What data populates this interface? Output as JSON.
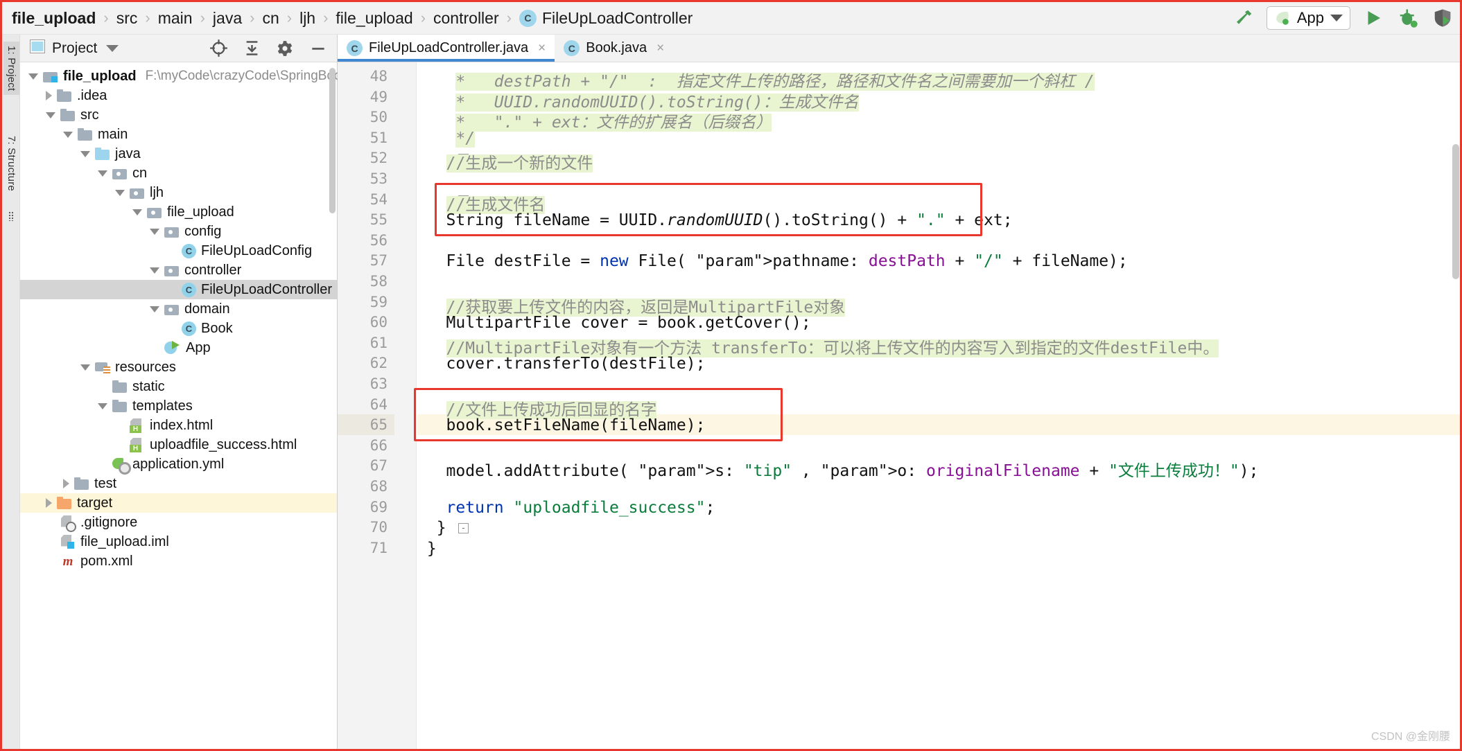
{
  "breadcrumb": {
    "items": [
      {
        "label": "file_upload",
        "bold": true
      },
      {
        "label": "src",
        "bold": false
      },
      {
        "label": "main",
        "bold": false
      },
      {
        "label": "java",
        "bold": false
      },
      {
        "label": "cn",
        "bold": false
      },
      {
        "label": "ljh",
        "bold": false
      },
      {
        "label": "file_upload",
        "bold": false
      },
      {
        "label": "controller",
        "bold": false
      }
    ],
    "current_class": "FileUpLoadController",
    "class_badge": "C",
    "separator": "›"
  },
  "toolbar": {
    "build_icon": "hammer-icon",
    "run_config": "App",
    "run_icon": "run-icon",
    "debug_icon": "debug-icon",
    "coverage_icon": "run-with-coverage-icon"
  },
  "left_strip": {
    "project_tab": "1: Project",
    "structure_tab": "7: Structure"
  },
  "project_panel": {
    "title": "Project",
    "icons": [
      "locate-icon",
      "collapse-all-icon",
      "settings-icon",
      "hide-icon"
    ],
    "tree": [
      {
        "depth": 0,
        "arrow": "down",
        "icon": "module",
        "label": "file_upload",
        "bold": true,
        "path": "F:\\myCode\\crazyCode\\SpringBoot\\sprin",
        "state": "normal"
      },
      {
        "depth": 1,
        "arrow": "right",
        "icon": "folder",
        "label": ".idea",
        "bold": false,
        "path": "",
        "state": "normal"
      },
      {
        "depth": 1,
        "arrow": "down",
        "icon": "folder",
        "label": "src",
        "bold": false,
        "path": "",
        "state": "normal"
      },
      {
        "depth": 2,
        "arrow": "down",
        "icon": "folder",
        "label": "main",
        "bold": false,
        "path": "",
        "state": "normal"
      },
      {
        "depth": 3,
        "arrow": "down",
        "icon": "folder blue",
        "label": "java",
        "bold": false,
        "path": "",
        "state": "normal"
      },
      {
        "depth": 4,
        "arrow": "down",
        "icon": "pkg",
        "label": "cn",
        "bold": false,
        "path": "",
        "state": "normal"
      },
      {
        "depth": 5,
        "arrow": "down",
        "icon": "pkg",
        "label": "ljh",
        "bold": false,
        "path": "",
        "state": "normal"
      },
      {
        "depth": 6,
        "arrow": "down",
        "icon": "pkg",
        "label": "file_upload",
        "bold": false,
        "path": "",
        "state": "normal"
      },
      {
        "depth": 7,
        "arrow": "down",
        "icon": "pkg",
        "label": "config",
        "bold": false,
        "path": "",
        "state": "normal"
      },
      {
        "depth": 8,
        "arrow": "none",
        "icon": "cls",
        "label": "FileUpLoadConfig",
        "bold": false,
        "path": "",
        "state": "normal"
      },
      {
        "depth": 7,
        "arrow": "down",
        "icon": "pkg",
        "label": "controller",
        "bold": false,
        "path": "",
        "state": "normal"
      },
      {
        "depth": 8,
        "arrow": "none",
        "icon": "cls",
        "label": "FileUpLoadController",
        "bold": false,
        "path": "",
        "state": "selected"
      },
      {
        "depth": 7,
        "arrow": "down",
        "icon": "pkg",
        "label": "domain",
        "bold": false,
        "path": "",
        "state": "normal"
      },
      {
        "depth": 8,
        "arrow": "none",
        "icon": "cls",
        "label": "Book",
        "bold": false,
        "path": "",
        "state": "normal"
      },
      {
        "depth": 7,
        "arrow": "none",
        "icon": "springrun",
        "label": "App",
        "bold": false,
        "path": "",
        "state": "normal"
      },
      {
        "depth": 3,
        "arrow": "down",
        "icon": "res",
        "label": "resources",
        "bold": false,
        "path": "",
        "state": "normal"
      },
      {
        "depth": 4,
        "arrow": "none",
        "icon": "folder",
        "label": "static",
        "bold": false,
        "path": "",
        "state": "normal"
      },
      {
        "depth": 4,
        "arrow": "down",
        "icon": "folder",
        "label": "templates",
        "bold": false,
        "path": "",
        "state": "normal"
      },
      {
        "depth": 5,
        "arrow": "none",
        "icon": "html",
        "label": "index.html",
        "bold": false,
        "path": "",
        "state": "normal"
      },
      {
        "depth": 5,
        "arrow": "none",
        "icon": "html",
        "label": "uploadfile_success.html",
        "bold": false,
        "path": "",
        "state": "normal"
      },
      {
        "depth": 4,
        "arrow": "none",
        "icon": "spring",
        "label": "application.yml",
        "bold": false,
        "path": "",
        "state": "normal"
      },
      {
        "depth": 2,
        "arrow": "right",
        "icon": "folder",
        "label": "test",
        "bold": false,
        "path": "",
        "state": "normal"
      },
      {
        "depth": 1,
        "arrow": "right",
        "icon": "folder orange",
        "label": "target",
        "bold": false,
        "path": "",
        "state": "highlight"
      },
      {
        "depth": 1,
        "arrow": "none",
        "icon": "gitignore",
        "label": ".gitignore",
        "bold": false,
        "path": "",
        "state": "normal"
      },
      {
        "depth": 1,
        "arrow": "none",
        "icon": "iml",
        "label": "file_upload.iml",
        "bold": false,
        "path": "",
        "state": "normal"
      },
      {
        "depth": 1,
        "arrow": "none",
        "icon": "maven",
        "label": "pom.xml",
        "bold": false,
        "path": "",
        "state": "normal"
      }
    ]
  },
  "editor": {
    "tabs": [
      {
        "label": "FileUpLoadController.java",
        "badge": "C",
        "active": true,
        "close": "×"
      },
      {
        "label": "Book.java",
        "badge": "C",
        "active": false,
        "close": "×"
      }
    ],
    "first_line_number": 48,
    "current_line": 65,
    "lines": [
      {
        "n": 48,
        "fold": "",
        "text": "    *   destPath + \"/\"  :  指定文件上传的路径，路径和文件名之间需要加一个斜杠 /"
      },
      {
        "n": 49,
        "fold": "",
        "text": "    *   UUID.randomUUID().toString()：生成文件名"
      },
      {
        "n": 50,
        "fold": "",
        "text": "    *   \".\" + ext：文件的扩展名（后缀名）"
      },
      {
        "n": 51,
        "fold": "-",
        "text": "    */"
      },
      {
        "n": 52,
        "fold": "-",
        "text": "   //生成一个新的文件"
      },
      {
        "n": 53,
        "fold": "",
        "text": ""
      },
      {
        "n": 54,
        "fold": "-",
        "text": "   //生成文件名"
      },
      {
        "n": 55,
        "fold": "",
        "text": "   String fileName = UUID.randomUUID().toString() + \".\" + ext;"
      },
      {
        "n": 56,
        "fold": "",
        "text": ""
      },
      {
        "n": 57,
        "fold": "",
        "text": "   File destFile = new File( pathname: destPath + \"/\" + fileName);"
      },
      {
        "n": 58,
        "fold": "",
        "text": ""
      },
      {
        "n": 59,
        "fold": "",
        "text": "   //获取要上传文件的内容，返回是MultipartFile对象"
      },
      {
        "n": 60,
        "fold": "",
        "text": "   MultipartFile cover = book.getCover();"
      },
      {
        "n": 61,
        "fold": "",
        "text": "   //MultipartFile对象有一个方法 transferTo：可以将上传文件的内容写入到指定的文件destFile中。"
      },
      {
        "n": 62,
        "fold": "",
        "text": "   cover.transferTo(destFile);"
      },
      {
        "n": 63,
        "fold": "",
        "text": ""
      },
      {
        "n": 64,
        "fold": "",
        "text": "   //文件上传成功后回显的名字"
      },
      {
        "n": 65,
        "fold": "",
        "text": "   book.setFileName(fileName);"
      },
      {
        "n": 66,
        "fold": "",
        "text": ""
      },
      {
        "n": 67,
        "fold": "",
        "text": "   model.addAttribute( s: \"tip\" , o: originalFilename + \"文件上传成功！\");"
      },
      {
        "n": 68,
        "fold": "",
        "text": ""
      },
      {
        "n": 69,
        "fold": "",
        "text": "   return \"uploadfile_success\";"
      },
      {
        "n": 70,
        "fold": "-",
        "text": "  }"
      },
      {
        "n": 71,
        "fold": "",
        "text": " }"
      }
    ],
    "annotation_boxes": [
      {
        "name": "filename-generation-box",
        "lines": "54-55"
      },
      {
        "name": "setfilename-box",
        "lines": "64-65"
      }
    ]
  },
  "watermark": "CSDN @金刚腰",
  "colors": {
    "accent_red": "#e8372c",
    "tab_underline": "#3f87d1",
    "selection_gray": "#d4d4d4",
    "highlight_yellow": "#fdf6d8",
    "comment_green_bg": "#e9f5d0",
    "keyword_blue": "#0033b3",
    "string_green": "#0a7c3c",
    "field_purple": "#871094",
    "class_badge_blue": "#8fd2ea",
    "spring_green": "#6cb33f"
  }
}
